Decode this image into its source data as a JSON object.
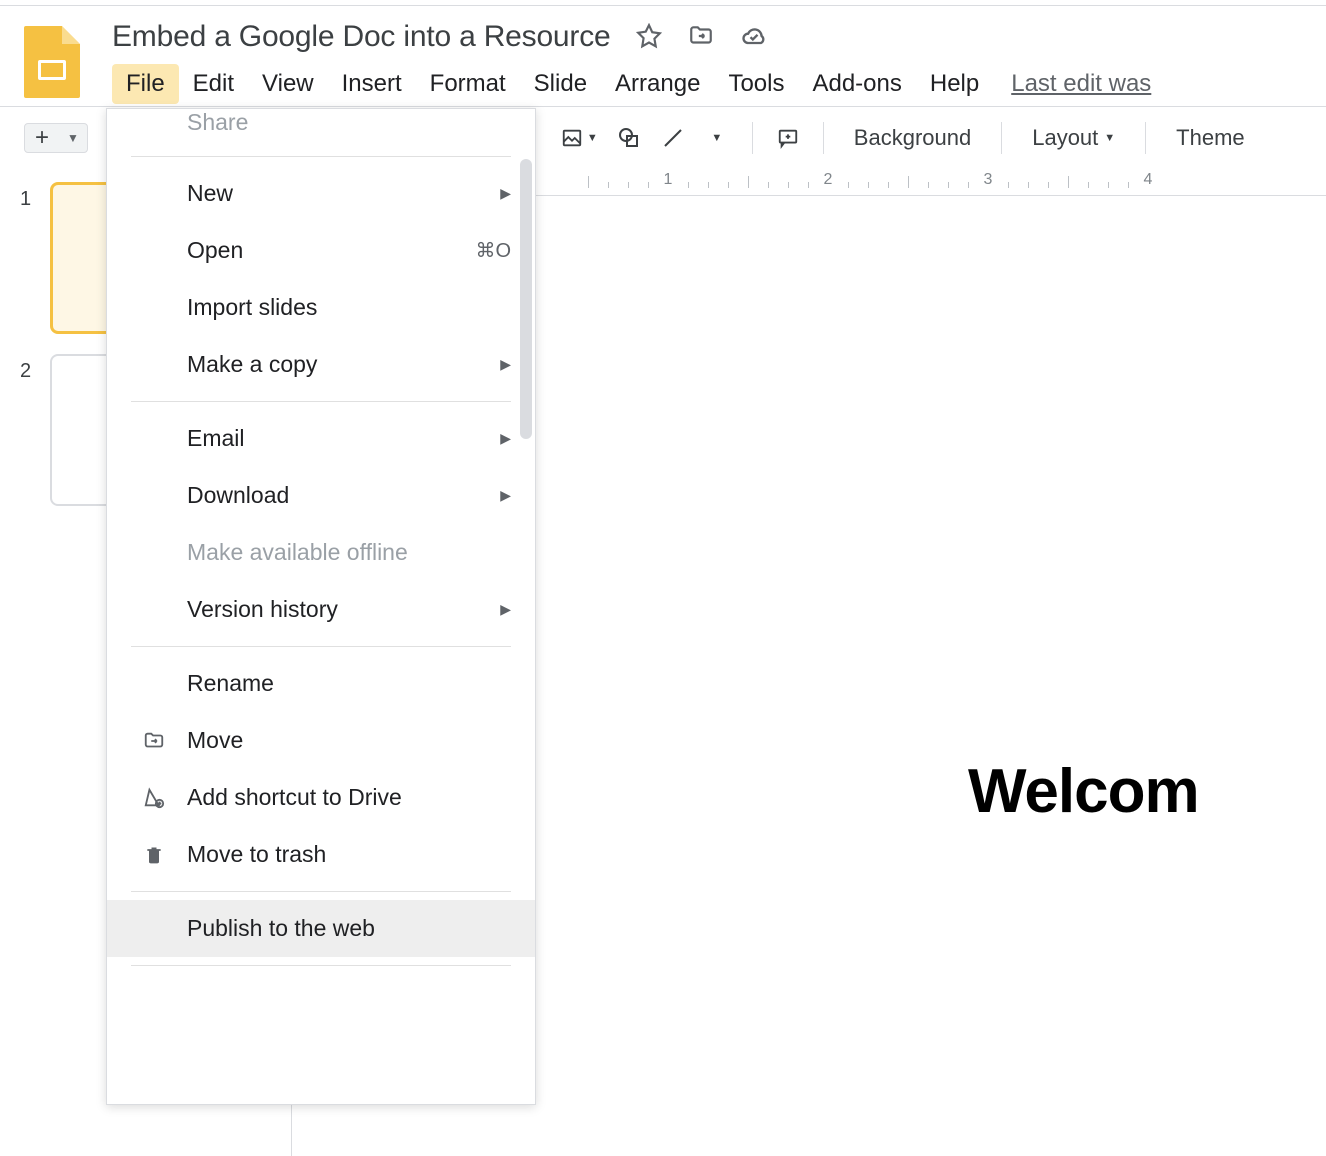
{
  "doc_title": "Embed a Google Doc into a Resource",
  "menubar": {
    "file": "File",
    "edit": "Edit",
    "view": "View",
    "insert": "Insert",
    "format": "Format",
    "slide": "Slide",
    "arrange": "Arrange",
    "tools": "Tools",
    "addons": "Add-ons",
    "help": "Help",
    "last_edit": "Last edit was"
  },
  "toolbar": {
    "background": "Background",
    "layout": "Layout",
    "theme": "Theme"
  },
  "ruler": {
    "n1": "1",
    "n2": "2",
    "n3": "3",
    "n4": "4"
  },
  "thumbnails": {
    "slide1_num": "1",
    "slide2_num": "2"
  },
  "canvas": {
    "welcome": "Welcom"
  },
  "file_menu": {
    "share": "Share",
    "new": "New",
    "open": "Open",
    "open_shortcut": "⌘O",
    "import_slides": "Import slides",
    "make_copy": "Make a copy",
    "email": "Email",
    "download": "Download",
    "offline": "Make available offline",
    "version_history": "Version history",
    "rename": "Rename",
    "move": "Move",
    "add_shortcut": "Add shortcut to Drive",
    "move_trash": "Move to trash",
    "publish": "Publish to the web"
  }
}
